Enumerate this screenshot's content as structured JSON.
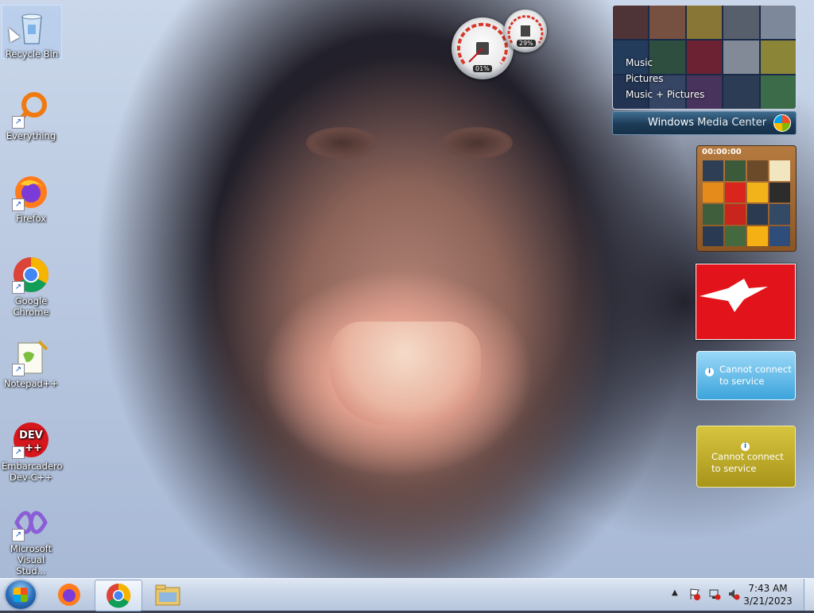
{
  "desktop": {
    "icons": [
      {
        "label": "Recycle Bin",
        "icon": "recycle-bin-icon"
      },
      {
        "label": "Everything",
        "icon": "everything-search-icon"
      },
      {
        "label": "Firefox",
        "icon": "firefox-icon"
      },
      {
        "label": "Google Chrome",
        "icon": "chrome-icon"
      },
      {
        "label": "Notepad++",
        "icon": "notepad-plus-plus-icon"
      },
      {
        "label": "Embarcadero Dev-C++",
        "icon": "dev-cpp-icon"
      },
      {
        "label": "Microsoft Visual Stud...",
        "icon": "visual-studio-icon"
      }
    ]
  },
  "gadgets": {
    "cpu_meter": {
      "cpu": "01%",
      "memory": "29%"
    },
    "media_center": {
      "menu": [
        "Music",
        "Pictures",
        "Music + Pictures"
      ],
      "title_main": "Windows",
      "title_sub": " Media Center"
    },
    "puzzle": {
      "timer": "00:00:00"
    },
    "feed_gadget": {
      "message": "Cannot connect to service"
    },
    "weather_gadget": {
      "message": "Cannot connect to service"
    }
  },
  "taskbar": {
    "pinned": [
      "Firefox",
      "Google Chrome",
      "File Explorer"
    ],
    "active": "Google Chrome",
    "clock": {
      "time": "7:43 AM",
      "date": "3/21/2023"
    }
  }
}
